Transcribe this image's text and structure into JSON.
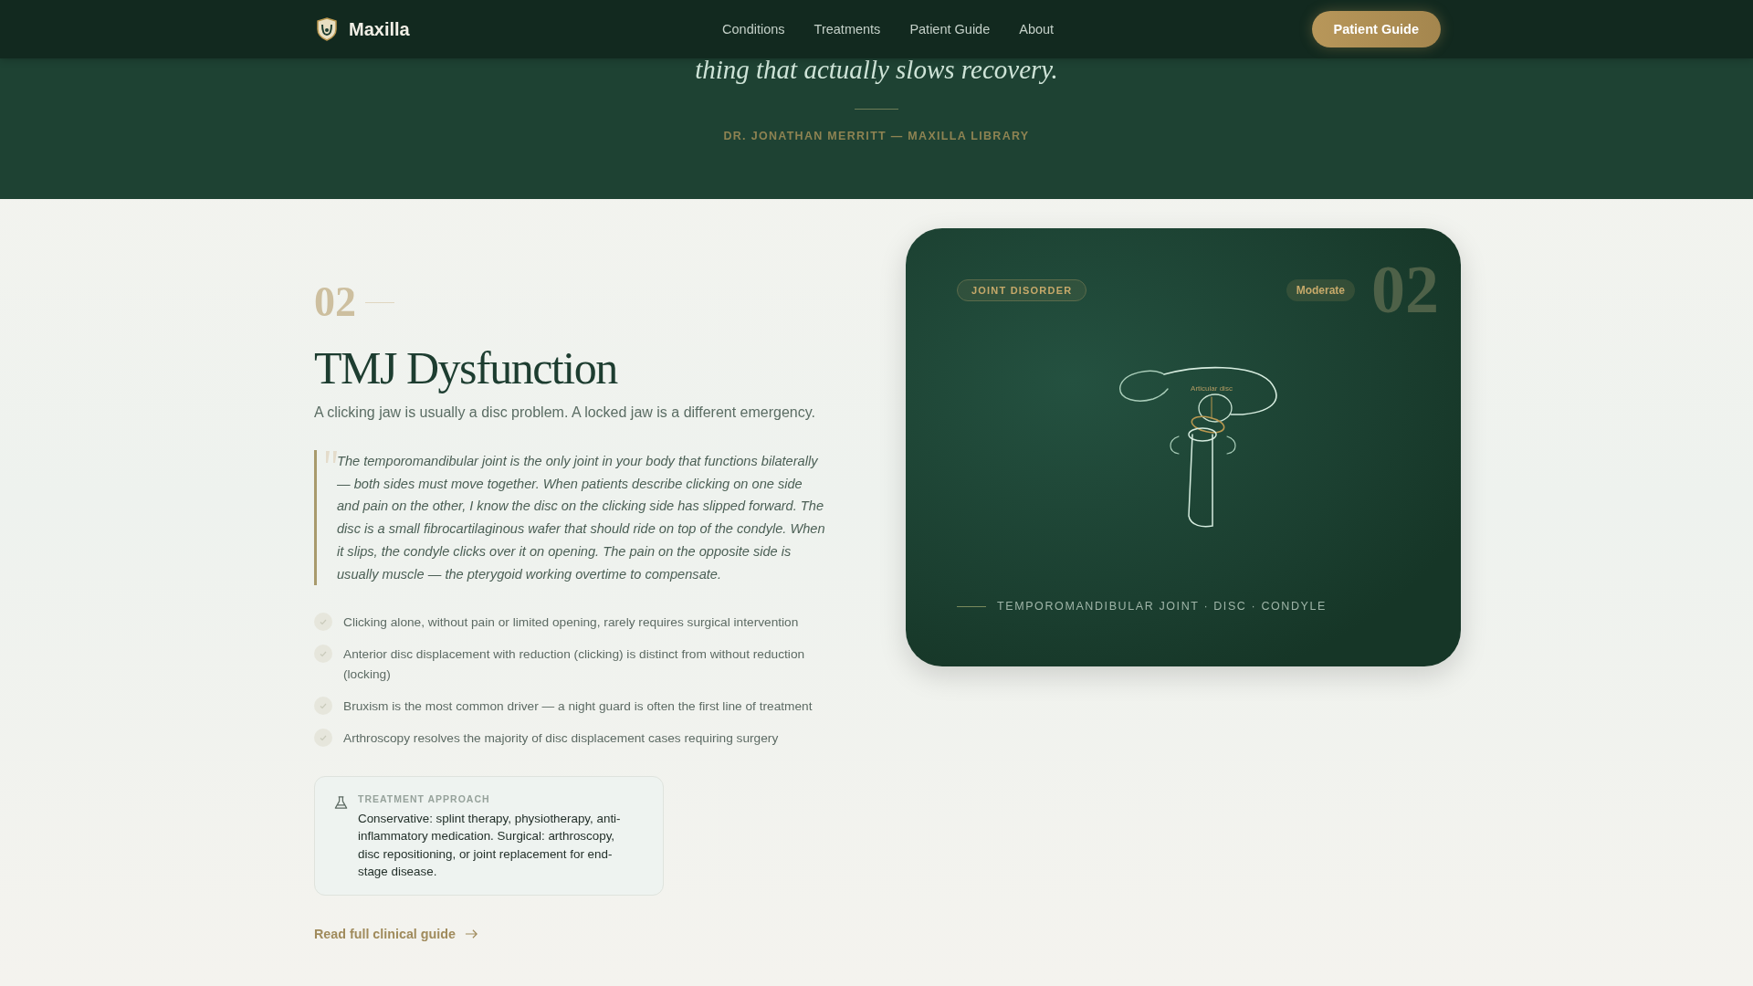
{
  "nav": {
    "brand": "Maxilla",
    "links": [
      "Conditions",
      "Treatments",
      "Patient Guide",
      "About"
    ],
    "cta": "Patient Guide"
  },
  "hero": {
    "quote_fragment": "thing that actually slows recovery.",
    "attribution": "DR. JONATHAN MERRITT — MAXILLA LIBRARY"
  },
  "section": {
    "number": "02",
    "title": "TMJ Dysfunction",
    "lede": "A clicking jaw is usually a disc problem. A locked jaw is a different emergency.",
    "quote": "The temporomandibular joint is the only joint in your body that functions bilaterally — both sides must move together. When patients describe clicking on one side and pain on the other, I know the disc on the clicking side has slipped forward. The disc is a small fibrocartilaginous wafer that should ride on top of the condyle. When it slips, the condyle clicks over it on opening. The pain on the opposite side is usually muscle — the pterygoid working overtime to compensate.",
    "points": [
      "Clicking alone, without pain or limited opening, rarely requires surgical intervention",
      "Anterior disc displacement with reduction (clicking) is distinct from without reduction (locking)",
      "Bruxism is the most common driver — a night guard is often the first line of treatment",
      "Arthroscopy resolves the majority of disc displacement cases requiring surgery"
    ],
    "treatment": {
      "label": "TREATMENT APPROACH",
      "text": "Conservative: splint therapy, physiotherapy, anti-inflammatory medication. Surgical: arthroscopy, disc repositioning, or joint replacement for end-stage disease."
    },
    "link": "Read full clinical guide"
  },
  "card": {
    "tag": "JOINT DISORDER",
    "severity": "Moderate",
    "number": "02",
    "diagram_label": "Articular disc",
    "caption": "TEMPOROMANDIBULAR JOINT · DISC · CONDYLE"
  }
}
